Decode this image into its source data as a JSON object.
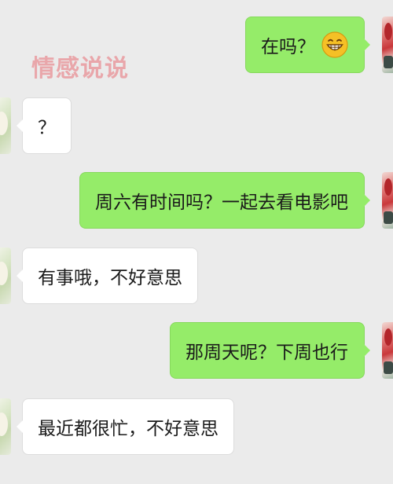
{
  "watermark": "情感说说",
  "messages": [
    {
      "side": "out",
      "text": "在吗？",
      "emoji": "grinning-face-emoji"
    },
    {
      "side": "in",
      "text": "？"
    },
    {
      "side": "out",
      "text": "周六有时间吗？一起去看电影吧"
    },
    {
      "side": "in",
      "text": "有事哦，不好意思"
    },
    {
      "side": "out",
      "text": "那周天呢？下周也行"
    },
    {
      "side": "in",
      "text": "最近都很忙，不好意思"
    }
  ],
  "colors": {
    "background": "#ebebeb",
    "outgoing_bubble": "#95ec69",
    "incoming_bubble": "#ffffff",
    "watermark": "#e9a6aa"
  }
}
